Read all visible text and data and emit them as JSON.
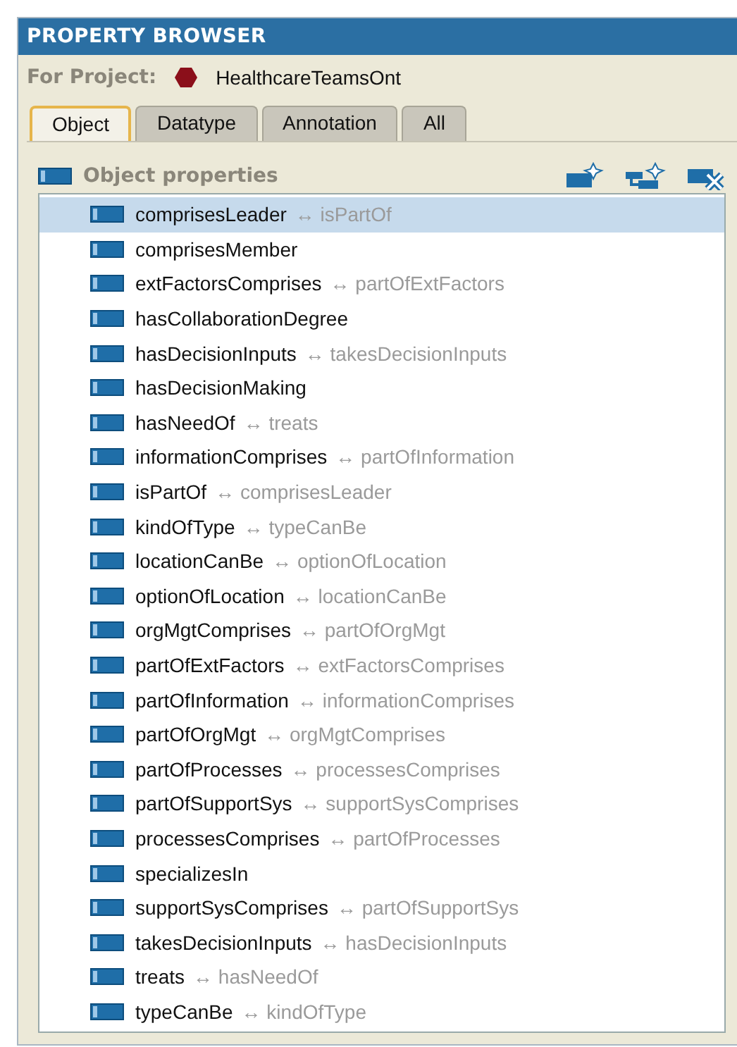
{
  "window": {
    "title": "PROPERTY BROWSER"
  },
  "project": {
    "label": "For Project:",
    "name": "HealthcareTeamsOnt"
  },
  "tabs": [
    {
      "label": "Object",
      "selected": true
    },
    {
      "label": "Datatype",
      "selected": false
    },
    {
      "label": "Annotation",
      "selected": false
    },
    {
      "label": "All",
      "selected": false
    }
  ],
  "tree": {
    "title": "Object properties",
    "items": [
      {
        "name": "comprisesLeader",
        "inverse": "↔ isPartOf",
        "selected": true
      },
      {
        "name": "comprisesMember",
        "selected": false
      },
      {
        "name": "extFactorsComprises",
        "inverse": "↔ partOfExtFactors",
        "selected": false
      },
      {
        "name": "hasCollaborationDegree",
        "selected": false
      },
      {
        "name": "hasDecisionInputs",
        "inverse": "↔ takesDecisionInputs",
        "selected": false
      },
      {
        "name": "hasDecisionMaking",
        "selected": false
      },
      {
        "name": "hasNeedOf",
        "inverse": "↔ treats",
        "selected": false
      },
      {
        "name": "informationComprises",
        "inverse": "↔ partOfInformation",
        "selected": false
      },
      {
        "name": "isPartOf",
        "inverse": "↔ comprisesLeader",
        "selected": false
      },
      {
        "name": "kindOfType",
        "inverse": "↔ typeCanBe",
        "selected": false
      },
      {
        "name": "locationCanBe",
        "inverse": "↔ optionOfLocation",
        "selected": false
      },
      {
        "name": "optionOfLocation",
        "inverse": "↔ locationCanBe",
        "selected": false
      },
      {
        "name": "orgMgtComprises",
        "inverse": "↔ partOfOrgMgt",
        "selected": false
      },
      {
        "name": "partOfExtFactors",
        "inverse": "↔ extFactorsComprises",
        "selected": false
      },
      {
        "name": "partOfInformation",
        "inverse": "↔ informationComprises",
        "selected": false
      },
      {
        "name": "partOfOrgMgt",
        "inverse": "↔ orgMgtComprises",
        "selected": false
      },
      {
        "name": "partOfProcesses",
        "inverse": "↔ processesComprises",
        "selected": false
      },
      {
        "name": "partOfSupportSys",
        "inverse": "↔ supportSysComprises",
        "selected": false
      },
      {
        "name": "processesComprises",
        "inverse": "↔ partOfProcesses",
        "selected": false
      },
      {
        "name": "specializesIn",
        "selected": false
      },
      {
        "name": "supportSysComprises",
        "inverse": "↔ partOfSupportSys",
        "selected": false
      },
      {
        "name": "takesDecisionInputs",
        "inverse": "↔ hasDecisionInputs",
        "selected": false
      },
      {
        "name": "treats",
        "inverse": "↔ hasNeedOf",
        "selected": false
      },
      {
        "name": "typeCanBe",
        "inverse": "↔ kindOfType",
        "selected": false
      }
    ]
  }
}
